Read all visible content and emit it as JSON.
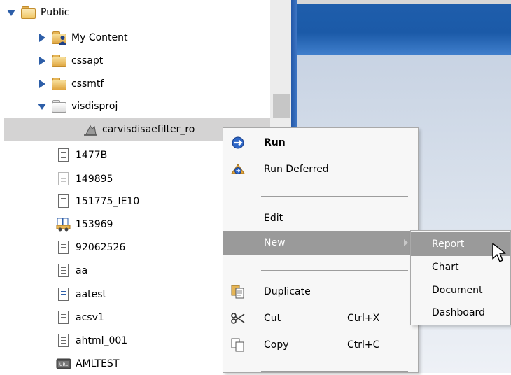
{
  "tree": {
    "items": [
      {
        "label": "Public",
        "icon": "folder-open-icon"
      },
      {
        "label": "My Content",
        "icon": "user-folder-icon"
      },
      {
        "label": "cssapt",
        "icon": "folder-icon"
      },
      {
        "label": "cssmtf",
        "icon": "folder-icon"
      },
      {
        "label": "visdisproj",
        "icon": "folder-grey-icon"
      },
      {
        "label": "carvisdisaefilter_ro",
        "icon": "filter-report-icon"
      },
      {
        "label": "1477B",
        "icon": "document-icon"
      },
      {
        "label": "149895",
        "icon": "document-pale-icon"
      },
      {
        "label": "151775_IE10",
        "icon": "document-icon"
      },
      {
        "label": "153969",
        "icon": "procedure-icon"
      },
      {
        "label": "92062526",
        "icon": "document-icon"
      },
      {
        "label": "aa",
        "icon": "document-icon"
      },
      {
        "label": "aatest",
        "icon": "document-blue-icon"
      },
      {
        "label": "acsv1",
        "icon": "document-icon"
      },
      {
        "label": "ahtml_001",
        "icon": "document-icon"
      },
      {
        "label": "AMLTEST",
        "icon": "url-icon"
      }
    ]
  },
  "context_menu": {
    "run": "Run",
    "run_deferred": "Run Deferred",
    "edit": "Edit",
    "new": "New",
    "duplicate": "Duplicate",
    "cut": "Cut",
    "cut_shortcut": "Ctrl+X",
    "copy": "Copy",
    "copy_shortcut": "Ctrl+C"
  },
  "submenu": {
    "report": "Report",
    "chart": "Chart",
    "document": "Document",
    "dashboard": "Dashboard"
  },
  "colors": {
    "selection": "#d4d3d3",
    "menu_highlight": "#9a9a9a",
    "header_blue": "#1b5aa8",
    "folder_gold": "#e0a63f",
    "toggle_blue": "#2d5ea8"
  }
}
